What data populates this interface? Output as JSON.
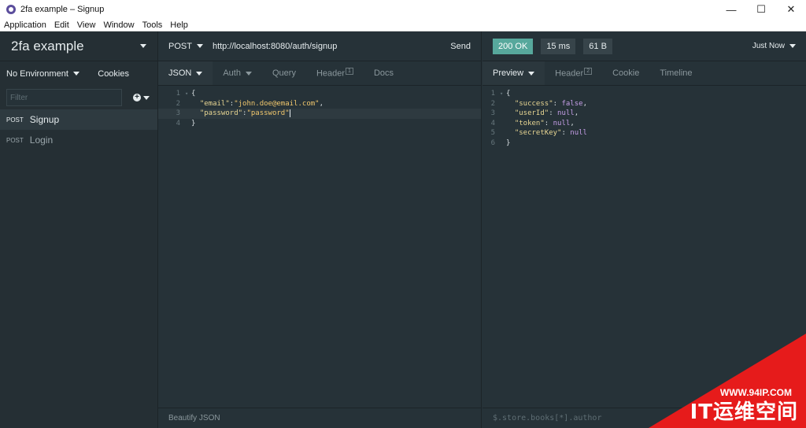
{
  "window": {
    "title": "2fa example – Signup",
    "minimize": "—",
    "maximize": "☐",
    "close": "✕"
  },
  "menu": [
    "Application",
    "Edit",
    "View",
    "Window",
    "Tools",
    "Help"
  ],
  "sidebar": {
    "workspace": "2fa example",
    "environment": "No Environment",
    "cookies": "Cookies",
    "filter_placeholder": "Filter",
    "requests": [
      {
        "method": "POST",
        "name": "Signup",
        "active": true
      },
      {
        "method": "POST",
        "name": "Login",
        "active": false
      }
    ]
  },
  "request": {
    "method": "POST",
    "url": "http://localhost:8080/auth/signup",
    "send": "Send",
    "tabs": [
      {
        "label": "JSON",
        "active": true
      },
      {
        "label": "Auth"
      },
      {
        "label": "Query"
      },
      {
        "label": "Header",
        "badge": "1"
      },
      {
        "label": "Docs"
      }
    ],
    "body_lines": [
      "1",
      "2",
      "3",
      "4"
    ],
    "email_key": "\"email\"",
    "email_value": "\"john.doe@email.com\"",
    "password_key": "\"password\"",
    "password_value": "\"password\"",
    "footer": "Beautify JSON"
  },
  "response": {
    "status": "200 OK",
    "time": "15 ms",
    "size": "61 B",
    "when": "Just Now",
    "tabs": [
      {
        "label": "Preview",
        "active": true
      },
      {
        "label": "Header",
        "badge": "2"
      },
      {
        "label": "Cookie"
      },
      {
        "label": "Timeline"
      }
    ],
    "body": {
      "success_key": "\"success\"",
      "success_val": "false",
      "userId_key": "\"userId\"",
      "userId_val": "null",
      "token_key": "\"token\"",
      "token_val": "null",
      "secretKey_key": "\"secretKey\"",
      "secretKey_val": "null"
    },
    "filter_placeholder": "$.store.books[*].author"
  },
  "watermark": {
    "url": "WWW.94IP.COM",
    "text": "IT运维空间"
  },
  "colors": {
    "status_ok": "#57a89c",
    "background": "#263238",
    "watermark": "#e61b1b"
  }
}
